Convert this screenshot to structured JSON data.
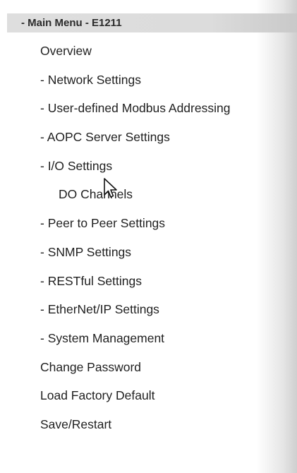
{
  "menu": {
    "header": "- Main Menu - E1211",
    "items": [
      {
        "label": "Overview"
      },
      {
        "label": "- Network Settings"
      },
      {
        "label": "- User-defined Modbus Addressing"
      },
      {
        "label": "- AOPC Server Settings"
      },
      {
        "label": "- I/O Settings"
      },
      {
        "label": "DO Channels"
      },
      {
        "label": "- Peer to Peer Settings"
      },
      {
        "label": "- SNMP Settings"
      },
      {
        "label": "- RESTful Settings"
      },
      {
        "label": "- EtherNet/IP Settings"
      },
      {
        "label": "- System Management"
      },
      {
        "label": "Change Password"
      },
      {
        "label": "Load Factory Default"
      },
      {
        "label": "Save/Restart"
      }
    ]
  },
  "icons": {
    "cursor": "mouse-pointer-icon"
  }
}
